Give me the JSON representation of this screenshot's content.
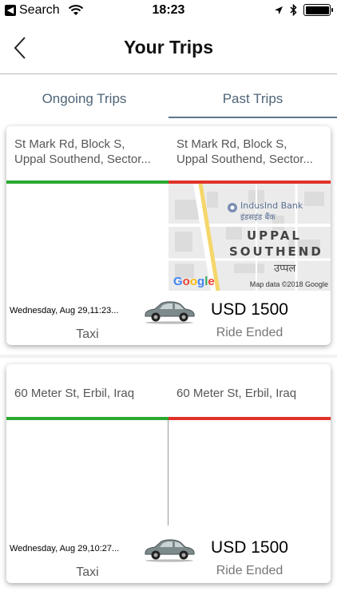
{
  "status_bar": {
    "back_app": "Search",
    "time": "18:23"
  },
  "header": {
    "title": "Your Trips"
  },
  "tabs": [
    {
      "label": "Ongoing Trips",
      "active": false
    },
    {
      "label": "Past Trips",
      "active": true
    }
  ],
  "map": {
    "poi_name": "IndusInd Bank",
    "poi_name_local": "इंडसइंड बैंक",
    "area_line1": "UPPAL",
    "area_line2": "SOUTHEND",
    "area_local": "उप्पल",
    "logo": "Google",
    "attribution": "Map data ©2018 Google"
  },
  "trips": [
    {
      "pickup_line1": "St Mark Rd, Block S,",
      "pickup_line2": "Uppal Southend, Sector...",
      "drop_line1": "St Mark Rd, Block S,",
      "drop_line2": "Uppal Southend, Sector...",
      "date": "Wednesday, Aug 29,11:23...",
      "price": "USD 1500",
      "service": "Taxi",
      "status": "Ride Ended",
      "has_map": true,
      "vehicle_icon": "car-icon"
    },
    {
      "pickup_line1": "60 Meter St, Erbil, Iraq",
      "drop_line1": "60 Meter St, Erbil, Iraq",
      "date": "Wednesday, Aug 29,10:27...",
      "price": "USD 1500",
      "service": "Taxi",
      "status": "Ride Ended",
      "has_map": false,
      "vehicle_icon": "car-icon"
    }
  ],
  "colors": {
    "pickup_line": "#2aa830",
    "drop_line": "#e0322a",
    "tab_text": "#4e6477"
  }
}
